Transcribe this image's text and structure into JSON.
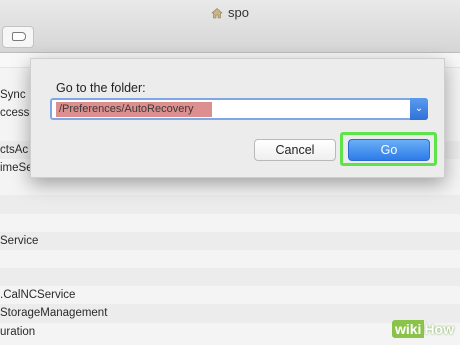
{
  "window": {
    "title": "spo",
    "home_icon": "house-icon"
  },
  "toolbar": {
    "tag_icon": "tag-icon"
  },
  "file_list": [
    {
      "name": "",
      "alt": false
    },
    {
      "name": "Sync",
      "alt": false
    },
    {
      "name": "ccess",
      "alt": false
    },
    {
      "name": "",
      "alt": false
    },
    {
      "name": "ctsAc",
      "alt": true
    },
    {
      "name": "imeService",
      "alt": false
    },
    {
      "name": "",
      "alt": false
    },
    {
      "name": "",
      "alt": true
    },
    {
      "name": "",
      "alt": false
    },
    {
      "name": "Service",
      "alt": true
    },
    {
      "name": "",
      "alt": false
    },
    {
      "name": "",
      "alt": true
    },
    {
      "name": ".CalNCService",
      "alt": false
    },
    {
      "name": "StorageManagement",
      "alt": true
    },
    {
      "name": "uration",
      "alt": false
    }
  ],
  "dialog": {
    "label": "Go to the folder:",
    "path_value": "/Preferences/AutoRecovery",
    "cancel_label": "Cancel",
    "go_label": "Go"
  },
  "watermark": {
    "part1": "wiki",
    "part2": "How"
  },
  "colors": {
    "accent": "#2d7ce8",
    "highlight": "#5fe34a",
    "selection": "#dd8e8e"
  }
}
